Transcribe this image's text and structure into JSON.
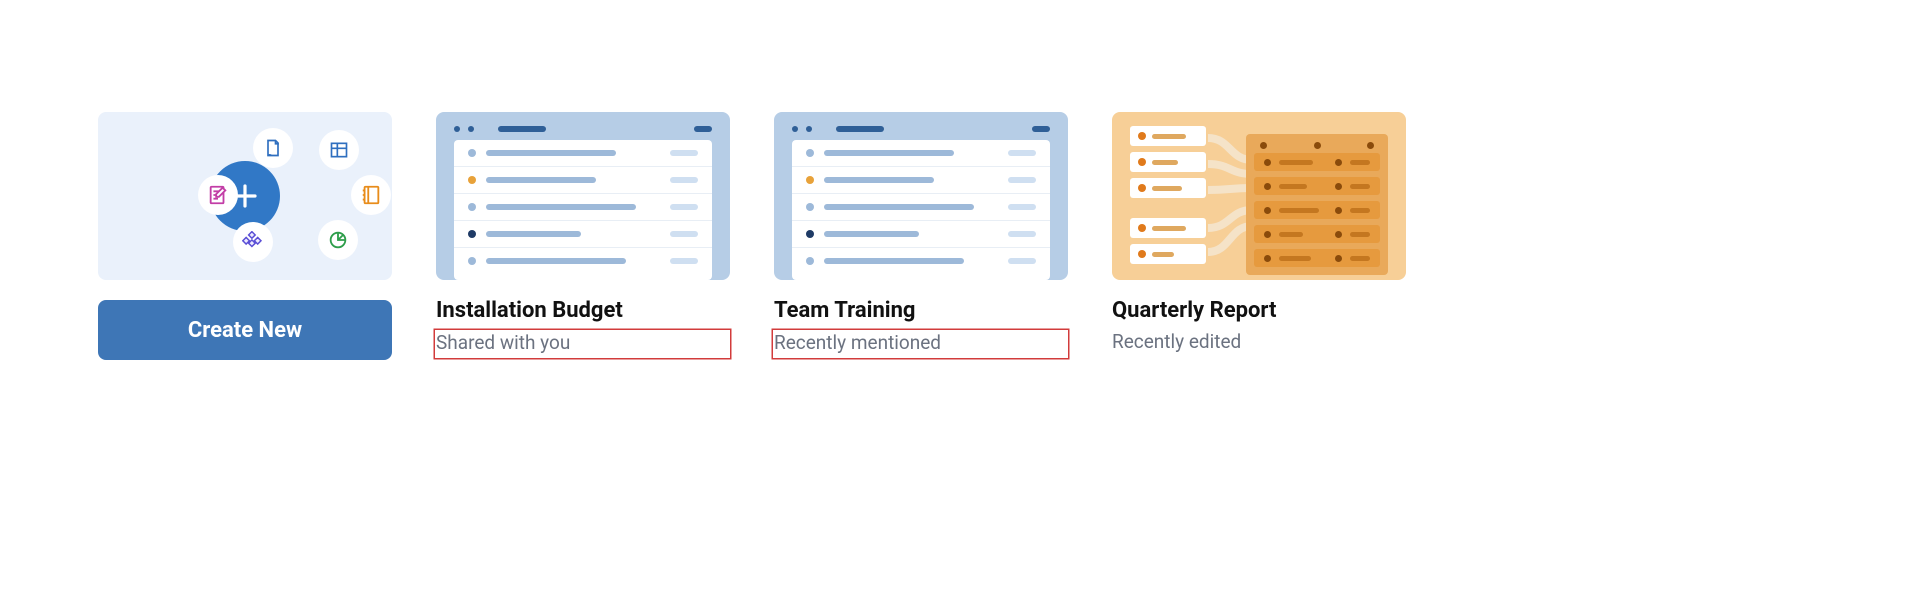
{
  "create_button_label": "Create New",
  "cards": [
    {
      "title": "Installation Budget",
      "subtitle": "Shared with you",
      "highlighted": true
    },
    {
      "title": "Team Training",
      "subtitle": "Recently mentioned",
      "highlighted": true
    },
    {
      "title": "Quarterly Report",
      "subtitle": "Recently edited",
      "highlighted": false
    }
  ]
}
